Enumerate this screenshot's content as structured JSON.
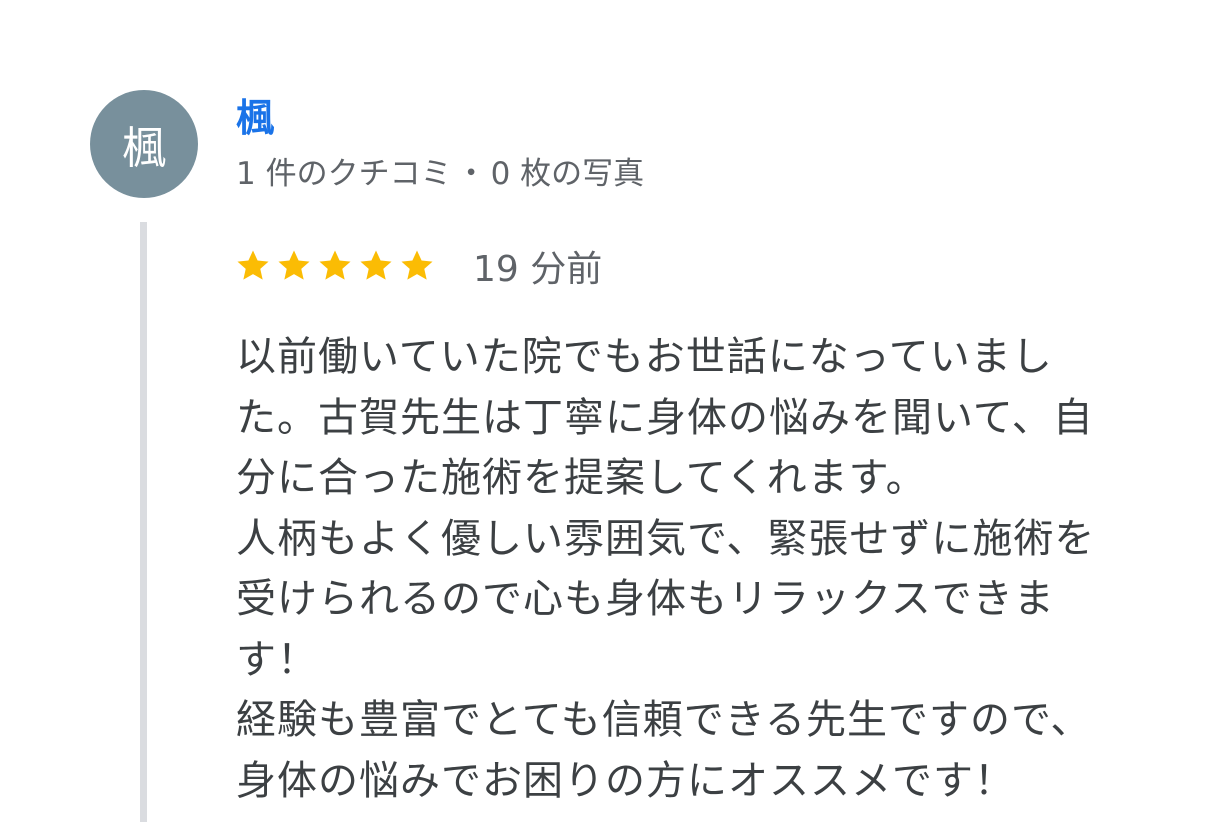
{
  "review": {
    "author": {
      "avatar_initial": "楓",
      "avatar_color": "#78909c",
      "name": "楓",
      "name_color": "#1a73e8",
      "review_count": "1 件のクチコミ",
      "separator": "・",
      "photo_count": "0 枚の写真"
    },
    "rating": {
      "stars": 5,
      "max": 5,
      "star_color": "#fbbc04",
      "star_icon": "star-icon"
    },
    "time_ago": "19 分前",
    "body_lines": [
      "以前働いていた院でもお世話になっていまし",
      "た。古賀先生は丁寧に身体の悩みを聞いて、自",
      "分に合った施術を提案してくれます。",
      "人柄もよく優しい雰囲気で、緊張せずに施術を",
      "受けられるので心も身体もリラックスできま",
      "す！",
      "経験も豊富でとても信頼できる先生ですので、",
      "身体の悩みでお困りの方にオススメです！"
    ]
  }
}
